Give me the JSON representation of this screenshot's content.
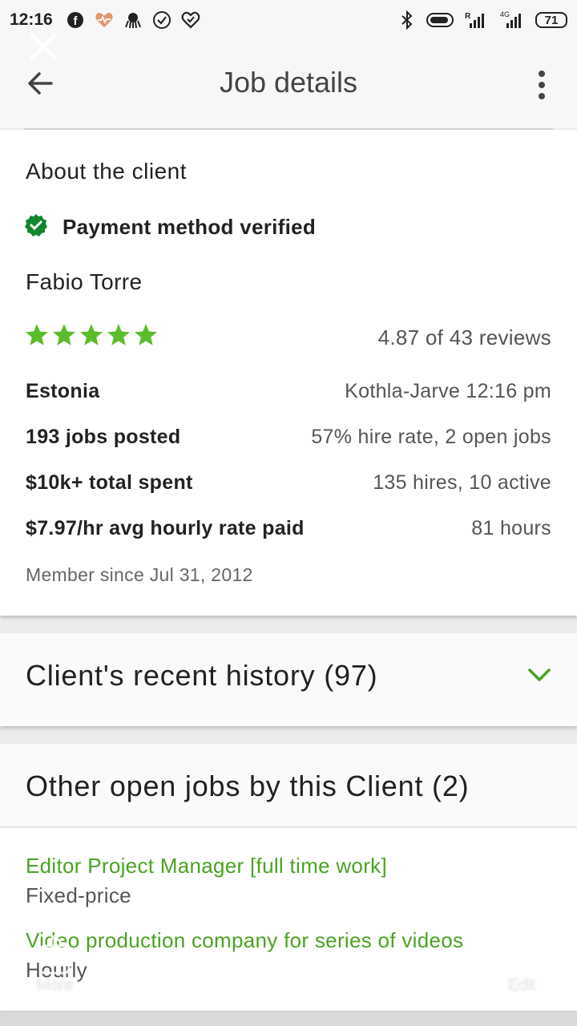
{
  "status_bar": {
    "time": "12:16",
    "battery": "71",
    "icons": [
      "facebook-icon",
      "heart-rate-icon",
      "octopus-icon",
      "check-circle-icon",
      "heart-icon",
      "bluetooth-icon",
      "toggle-icon",
      "signal-icon",
      "signal-4g-icon"
    ]
  },
  "app_bar": {
    "title": "Job details"
  },
  "client": {
    "section_title": "About the client",
    "payment_status": "Payment method verified",
    "name": "Fabio Torre",
    "rating_stars": 5,
    "reviews": "4.87 of 43 reviews",
    "rows": [
      {
        "key": "Estonia",
        "value": "Kothla-Jarve 12:16 pm"
      },
      {
        "key": "193 jobs posted",
        "value": "57% hire rate, 2 open jobs"
      },
      {
        "key": "$10k+ total spent",
        "value": "135 hires, 10 active"
      },
      {
        "key": "$7.97/hr avg hourly rate paid",
        "value": "81 hours"
      }
    ],
    "member_since": "Member since Jul 31, 2012"
  },
  "history": {
    "title": "Client's recent history (97)"
  },
  "other_jobs": {
    "title": "Other open jobs by this Client (2)",
    "items": [
      {
        "title": "Editor Project Manager [full time work]",
        "type": "Fixed-price"
      },
      {
        "title": "Video production company for series of videos",
        "type": "Hourly"
      }
    ]
  },
  "overlay": {
    "more_label": "More",
    "edit_label": "Edit"
  },
  "colors": {
    "accent_green": "#4aa323",
    "star_green": "#5cbd2c",
    "verified_green": "#14852f"
  }
}
